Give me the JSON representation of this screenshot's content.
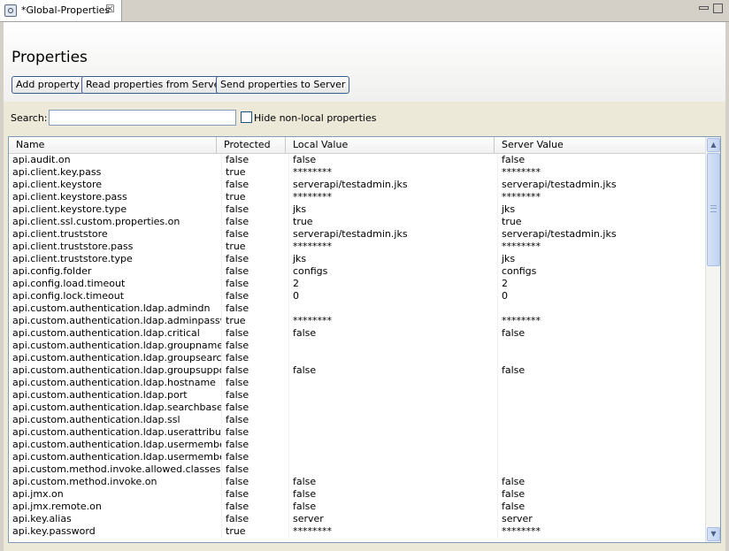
{
  "tab": {
    "title": "*Global-Properties",
    "close": "☒"
  },
  "page": {
    "title": "Properties"
  },
  "toolbar": {
    "add_label": "Add property",
    "read_label": "Read properties from Server",
    "send_label": "Send properties to Server"
  },
  "search": {
    "label": "Search:",
    "value": "",
    "hide_label": "Hide non-local properties",
    "hide_checked": false
  },
  "table": {
    "columns": [
      "Name",
      "Protected",
      "Local Value",
      "Server Value"
    ],
    "rows": [
      [
        "api.audit.on",
        "false",
        "false",
        "false"
      ],
      [
        "api.client.key.pass",
        "true",
        "********",
        "********"
      ],
      [
        "api.client.keystore",
        "false",
        "serverapi/testadmin.jks",
        "serverapi/testadmin.jks"
      ],
      [
        "api.client.keystore.pass",
        "true",
        "********",
        "********"
      ],
      [
        "api.client.keystore.type",
        "false",
        "jks",
        "jks"
      ],
      [
        "api.client.ssl.custom.properties.on",
        "false",
        "true",
        "true"
      ],
      [
        "api.client.truststore",
        "false",
        "serverapi/testadmin.jks",
        "serverapi/testadmin.jks"
      ],
      [
        "api.client.truststore.pass",
        "true",
        "********",
        "********"
      ],
      [
        "api.client.truststore.type",
        "false",
        "jks",
        "jks"
      ],
      [
        "api.config.folder",
        "false",
        "configs",
        "configs"
      ],
      [
        "api.config.load.timeout",
        "false",
        "2",
        "2"
      ],
      [
        "api.config.lock.timeout",
        "false",
        "0",
        "0"
      ],
      [
        "api.custom.authentication.ldap.admindn",
        "false",
        "",
        ""
      ],
      [
        "api.custom.authentication.ldap.adminpassword",
        "true",
        "********",
        "********"
      ],
      [
        "api.custom.authentication.ldap.critical",
        "false",
        "false",
        "false"
      ],
      [
        "api.custom.authentication.ldap.groupnameattribute",
        "false",
        "",
        ""
      ],
      [
        "api.custom.authentication.ldap.groupsearchbase",
        "false",
        "",
        ""
      ],
      [
        "api.custom.authentication.ldap.groupsupport",
        "false",
        "false",
        "false"
      ],
      [
        "api.custom.authentication.ldap.hostname",
        "false",
        "",
        ""
      ],
      [
        "api.custom.authentication.ldap.port",
        "false",
        "",
        ""
      ],
      [
        "api.custom.authentication.ldap.searchbase",
        "false",
        "",
        ""
      ],
      [
        "api.custom.authentication.ldap.ssl",
        "false",
        "",
        ""
      ],
      [
        "api.custom.authentication.ldap.userattribute",
        "false",
        "",
        ""
      ],
      [
        "api.custom.authentication.ldap.usermemberattribute",
        "false",
        "",
        ""
      ],
      [
        "api.custom.authentication.ldap.usermemberof",
        "false",
        "",
        ""
      ],
      [
        "api.custom.method.invoke.allowed.classes",
        "false",
        "",
        ""
      ],
      [
        "api.custom.method.invoke.on",
        "false",
        "false",
        "false"
      ],
      [
        "api.jmx.on",
        "false",
        "false",
        "false"
      ],
      [
        "api.jmx.remote.on",
        "false",
        "false",
        "false"
      ],
      [
        "api.key.alias",
        "false",
        "server",
        "server"
      ],
      [
        "api.key.password",
        "true",
        "********",
        "********"
      ]
    ]
  }
}
